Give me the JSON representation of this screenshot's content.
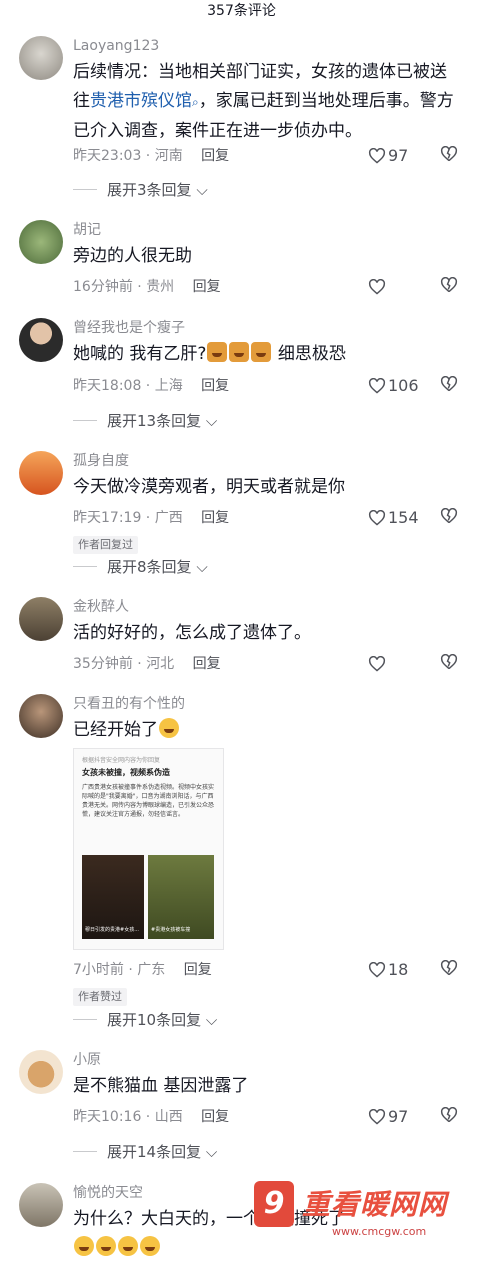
{
  "header": {
    "title": "357条评论"
  },
  "reply_label": "回复",
  "comments": [
    {
      "username": "Laoyang123",
      "text_pre": "后续情况：当地相关部门证实，女孩的遗体已被送往",
      "text_link": "贵港市殡仪馆",
      "text_post": "，家属已赶到当地处理后事。警方已介入调查，案件正在进一步侦办中。",
      "time": "昨天23:03",
      "location": "河南",
      "likes": "97",
      "expand": "展开3条回复"
    },
    {
      "username": "胡记",
      "text": "旁边的人很无助",
      "time": "16分钟前",
      "location": "贵州",
      "likes": ""
    },
    {
      "username": "曾经我也是个瘦子",
      "text_pre": "她喊的 我有乙肝?",
      "text_post": "细思极恐",
      "time": "昨天18:08",
      "location": "上海",
      "likes": "106",
      "expand": "展开13条回复"
    },
    {
      "username": "孤身自度",
      "text": "今天做冷漠旁观者，明天或者就是你",
      "time": "昨天17:19",
      "location": "广西",
      "likes": "154",
      "badge": "作者回复过",
      "expand": "展开8条回复"
    },
    {
      "username": "金秋醉人",
      "text": "活的好好的，怎么成了遗体了。",
      "time": "35分钟前",
      "location": "河北",
      "likes": ""
    },
    {
      "username": "只看丑的有个性的",
      "text": "已经开始了",
      "card": {
        "header": "根据抖音安全网内容为你回复",
        "title": "女孩未被撞，视频系伪造",
        "body": "广西贵港女孩被撞事件系伪造视频。视频中女孩实际喊的是\"我要离婚\"，口音为湖南浏阳话，与广西贵港无关。网传内容为博眼球编造，已引发公众恐慌，建议关注官方通报，勿轻信谣言。",
        "thumb1_caption": "穆日引发的贵港#女孩...",
        "thumb2_caption": "#贵港女孩被车撞"
      },
      "time": "7小时前",
      "location": "广东",
      "likes": "18",
      "badge": "作者赞过",
      "expand": "展开10条回复"
    },
    {
      "username": "小原",
      "text": "是不熊猫血 基因泄露了",
      "time": "昨天10:16",
      "location": "山西",
      "likes": "97",
      "expand": "展开14条回复"
    },
    {
      "username": "愉悦的天空",
      "text": "为什么？大白天的，一个人被撞死了"
    }
  ],
  "watermark": {
    "logo": "9",
    "text": "重看暖网网",
    "url": "www.cmcgw.com"
  },
  "colors": {
    "link": "#1f5fae",
    "meta": "#8a8b91",
    "watermark": "#e8503f"
  }
}
